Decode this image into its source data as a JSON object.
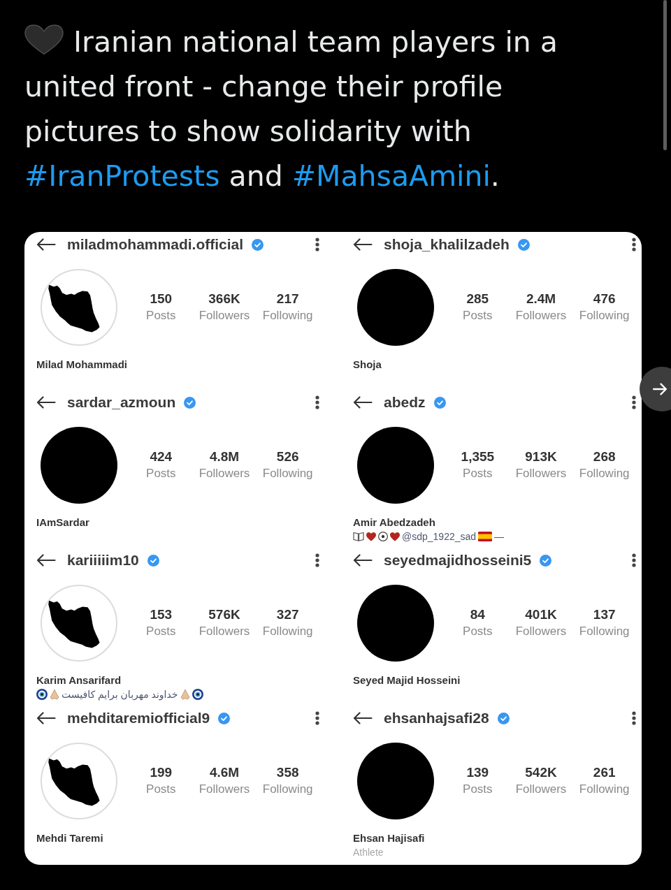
{
  "tweet": {
    "segments": [
      {
        "kind": "text",
        "text": "Iranian national team players in a united front - change their profile pictures to show solidarity with "
      },
      {
        "kind": "hashtag",
        "text": "#IranProtests"
      },
      {
        "kind": "text",
        "text": " and "
      },
      {
        "kind": "hashtag",
        "text": "#MahsaAmini"
      },
      {
        "kind": "text",
        "text": "."
      }
    ]
  },
  "profiles": [
    {
      "username": "miladmohammadi.official",
      "verified": true,
      "avatar": {
        "kind": "map"
      },
      "stats": [
        {
          "value": "150",
          "label": "Posts"
        },
        {
          "value": "366K",
          "label": "Followers"
        },
        {
          "value": "217",
          "label": "Following"
        }
      ],
      "name": "Milad Mohammadi"
    },
    {
      "username": "shoja_khalilzadeh",
      "verified": true,
      "avatar": {
        "kind": "solid"
      },
      "stats": [
        {
          "value": "285",
          "label": "Posts"
        },
        {
          "value": "2.4M",
          "label": "Followers"
        },
        {
          "value": "476",
          "label": "Following"
        }
      ],
      "name": "Shoja"
    },
    {
      "username": "sardar_azmoun",
      "verified": true,
      "avatar": {
        "kind": "solid"
      },
      "stats": [
        {
          "value": "424",
          "label": "Posts"
        },
        {
          "value": "4.8M",
          "label": "Followers"
        },
        {
          "value": "526",
          "label": "Following"
        }
      ],
      "name": "IAmSardar"
    },
    {
      "username": "abedz",
      "verified": true,
      "avatar": {
        "kind": "solid"
      },
      "stats": [
        {
          "value": "1,355",
          "label": "Posts"
        },
        {
          "value": "913K",
          "label": "Followers"
        },
        {
          "value": "268",
          "label": "Following"
        }
      ],
      "name": "Amir Abedzadeh",
      "bio": [
        {
          "kind": "book"
        },
        {
          "kind": "heart"
        },
        {
          "kind": "ball"
        },
        {
          "kind": "heart"
        },
        {
          "kind": "text",
          "text": "@sdp_1922_sad"
        },
        {
          "kind": "flag"
        },
        {
          "kind": "text",
          "text": "—"
        }
      ]
    },
    {
      "username": "kariiiiim10",
      "verified": true,
      "avatar": {
        "kind": "map"
      },
      "stats": [
        {
          "value": "153",
          "label": "Posts"
        },
        {
          "value": "576K",
          "label": "Followers"
        },
        {
          "value": "327",
          "label": "Following"
        }
      ],
      "name": "Karim Ansarifard",
      "bio": [
        {
          "kind": "bead"
        },
        {
          "kind": "hands"
        },
        {
          "kind": "text",
          "text": "خداوند مهربان برایم کافیست"
        },
        {
          "kind": "hands"
        },
        {
          "kind": "bead"
        }
      ]
    },
    {
      "username": "seyedmajidhosseini5",
      "verified": true,
      "avatar": {
        "kind": "solid"
      },
      "stats": [
        {
          "value": "84",
          "label": "Posts"
        },
        {
          "value": "401K",
          "label": "Followers"
        },
        {
          "value": "137",
          "label": "Following"
        }
      ],
      "name": "Seyed Majid Hosseini"
    },
    {
      "username": "mehditaremiofficial9",
      "verified": true,
      "avatar": {
        "kind": "map"
      },
      "stats": [
        {
          "value": "199",
          "label": "Posts"
        },
        {
          "value": "4.6M",
          "label": "Followers"
        },
        {
          "value": "358",
          "label": "Following"
        }
      ],
      "name": "Mehdi Taremi"
    },
    {
      "username": "ehsanhajsafi28",
      "verified": true,
      "avatar": {
        "kind": "solid"
      },
      "stats": [
        {
          "value": "139",
          "label": "Posts"
        },
        {
          "value": "542K",
          "label": "Followers"
        },
        {
          "value": "261",
          "label": "Following"
        }
      ],
      "name": "Ehsan Hajisafi",
      "bio": [
        {
          "kind": "category",
          "text": "Athlete"
        }
      ]
    }
  ]
}
